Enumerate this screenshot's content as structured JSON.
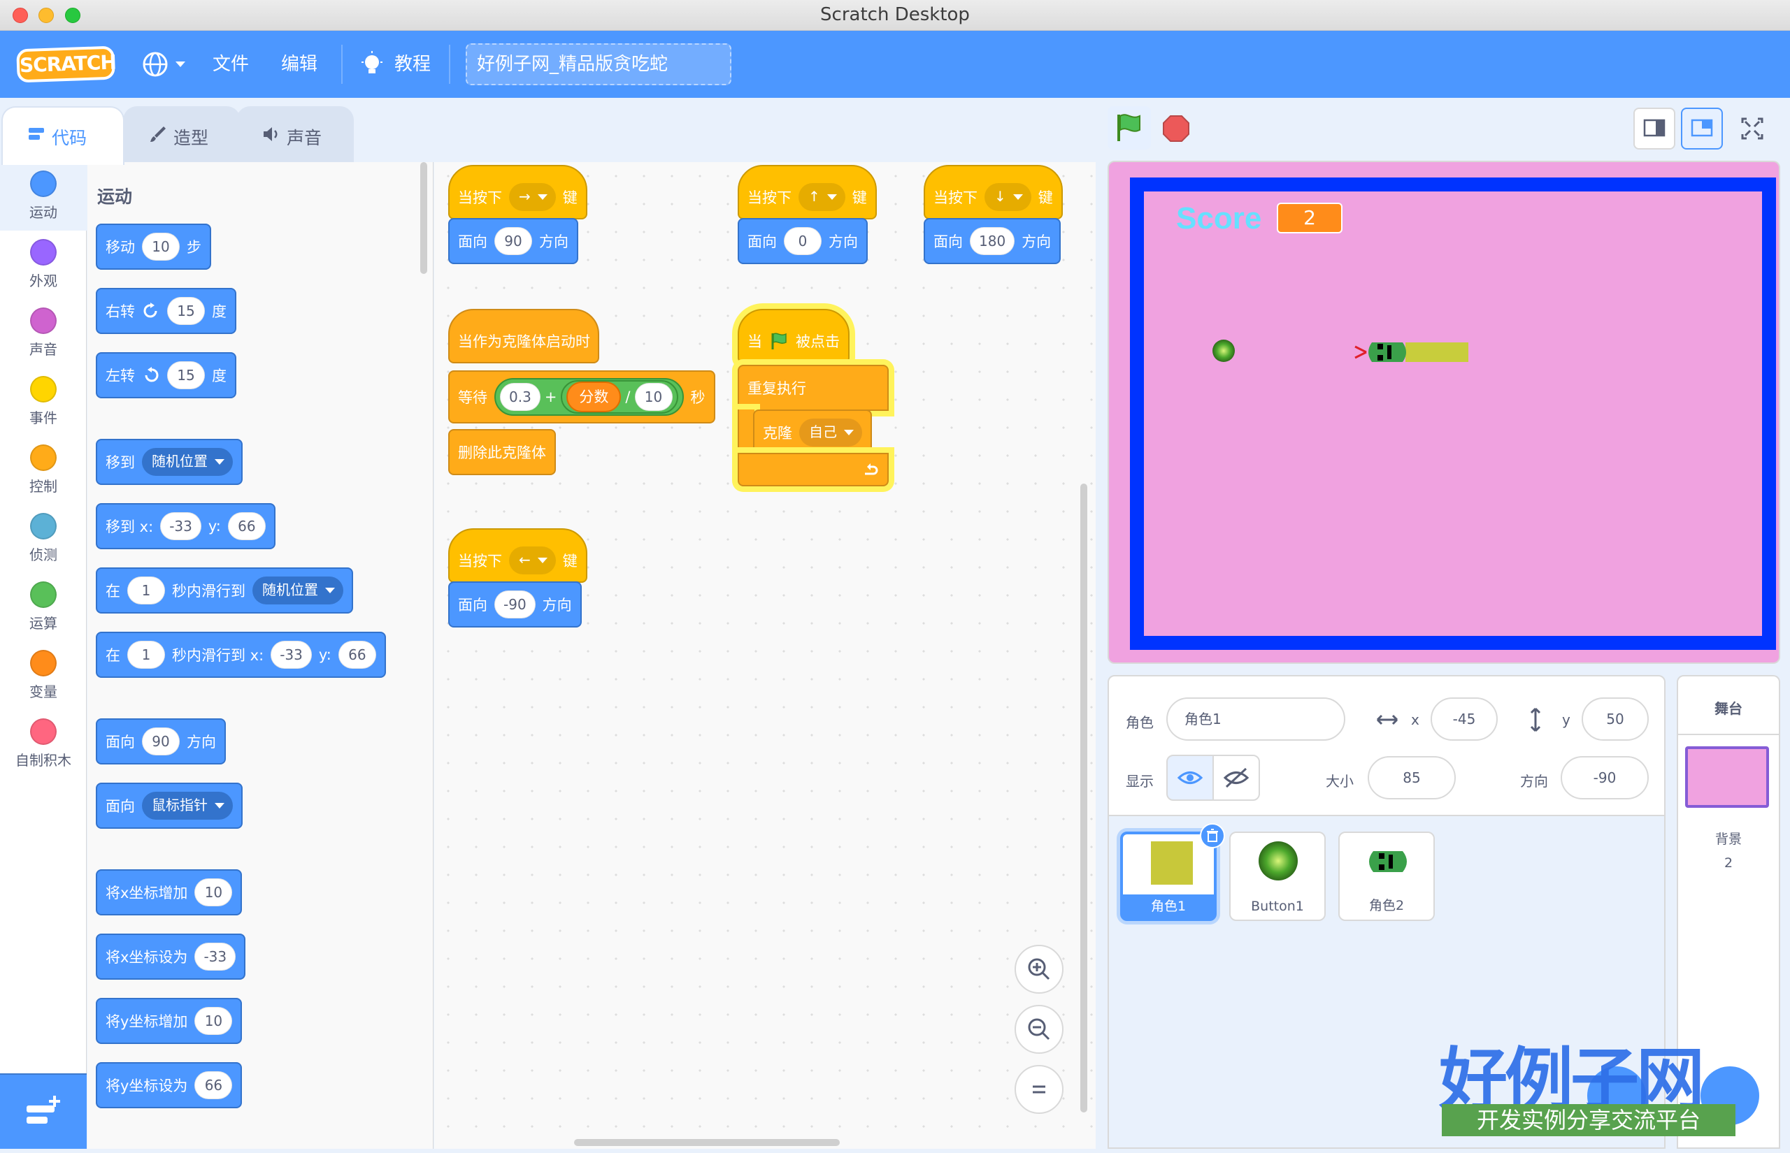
{
  "window": {
    "title": "Scratch Desktop"
  },
  "menubar": {
    "logo": "SCRATCH",
    "file": "文件",
    "edit": "编辑",
    "tutorials": "教程",
    "project_title": "好例子网_精品版贪吃蛇"
  },
  "tabs": {
    "code": "代码",
    "costumes": "造型",
    "sounds": "声音"
  },
  "categories": [
    {
      "label": "运动",
      "color": "#4c97ff"
    },
    {
      "label": "外观",
      "color": "#9966ff"
    },
    {
      "label": "声音",
      "color": "#cf63cf"
    },
    {
      "label": "事件",
      "color": "#ffd500"
    },
    {
      "label": "控制",
      "color": "#ffab19"
    },
    {
      "label": "侦测",
      "color": "#5cb1d6"
    },
    {
      "label": "运算",
      "color": "#59c059"
    },
    {
      "label": "变量",
      "color": "#ff8c1a"
    },
    {
      "label": "自制积木",
      "color": "#ff6680"
    }
  ],
  "palette": {
    "section": "运动",
    "move": {
      "a": "移动",
      "n": "10",
      "b": "步"
    },
    "turn_right": {
      "a": "右转",
      "n": "15",
      "b": "度"
    },
    "turn_left": {
      "a": "左转",
      "n": "15",
      "b": "度"
    },
    "goto": {
      "a": "移到",
      "menu": "随机位置"
    },
    "goto_xy": {
      "a": "移到 x:",
      "x": "-33",
      "ylabel": "y:",
      "y": "66"
    },
    "glide": {
      "a": "在",
      "n": "1",
      "b": "秒内滑行到",
      "menu": "随机位置"
    },
    "glide_xy": {
      "a": "在",
      "n": "1",
      "b": "秒内滑行到 x:",
      "x": "-33",
      "ylabel": "y:",
      "y": "66"
    },
    "point_dir": {
      "a": "面向",
      "n": "90",
      "b": "方向"
    },
    "point_towards": {
      "a": "面向",
      "menu": "鼠标指针"
    },
    "change_x": {
      "a": "将x坐标增加",
      "n": "10"
    },
    "set_x": {
      "a": "将x坐标设为",
      "n": "-33"
    },
    "change_y": {
      "a": "将y坐标增加",
      "n": "10"
    },
    "set_y": {
      "a": "将y坐标设为",
      "n": "66"
    }
  },
  "scripts": {
    "key_right": {
      "when": "当按下",
      "key": "→",
      "suffix": "键",
      "face": "面向",
      "dir": "90",
      "dir_suffix": "方向"
    },
    "key_up": {
      "when": "当按下",
      "key": "↑",
      "suffix": "键",
      "face": "面向",
      "dir": "0",
      "dir_suffix": "方向"
    },
    "key_down": {
      "when": "当按下",
      "key": "↓",
      "suffix": "键",
      "face": "面向",
      "dir": "180",
      "dir_suffix": "方向"
    },
    "key_left": {
      "when": "当按下",
      "key": "←",
      "suffix": "键",
      "face": "面向",
      "dir": "-90",
      "dir_suffix": "方向"
    },
    "clone_start": {
      "hat": "当作为克隆体启动时",
      "wait": "等待",
      "num": "0.3",
      "plus": "+",
      "var": "分数",
      "div": "/",
      "den": "10",
      "sec": "秒",
      "delete": "删除此克隆体"
    },
    "flag": {
      "when": "当",
      "clicked": "被点击",
      "forever": "重复执行",
      "clone": "克隆",
      "target": "自己"
    }
  },
  "stage": {
    "score_label": "Score",
    "score_value": "2",
    "bg_color": "#f0a2e0",
    "border_color": "#0033ff"
  },
  "sprite_info": {
    "sprite_label": "角色",
    "sprite_name": "角色1",
    "x_label": "x",
    "x": "-45",
    "y_label": "y",
    "y": "50",
    "show_label": "显示",
    "size_label": "大小",
    "size": "85",
    "direction_label": "方向",
    "direction": "-90"
  },
  "sprites": [
    {
      "name": "角色1",
      "selected": true
    },
    {
      "name": "Button1",
      "selected": false
    },
    {
      "name": "角色2",
      "selected": false
    }
  ],
  "stage_panel": {
    "title": "舞台",
    "backdrops_label": "背景",
    "backdrops_count": "2"
  },
  "watermark": {
    "title": "好例子网",
    "subtitle": "开发实例分享交流平台"
  }
}
